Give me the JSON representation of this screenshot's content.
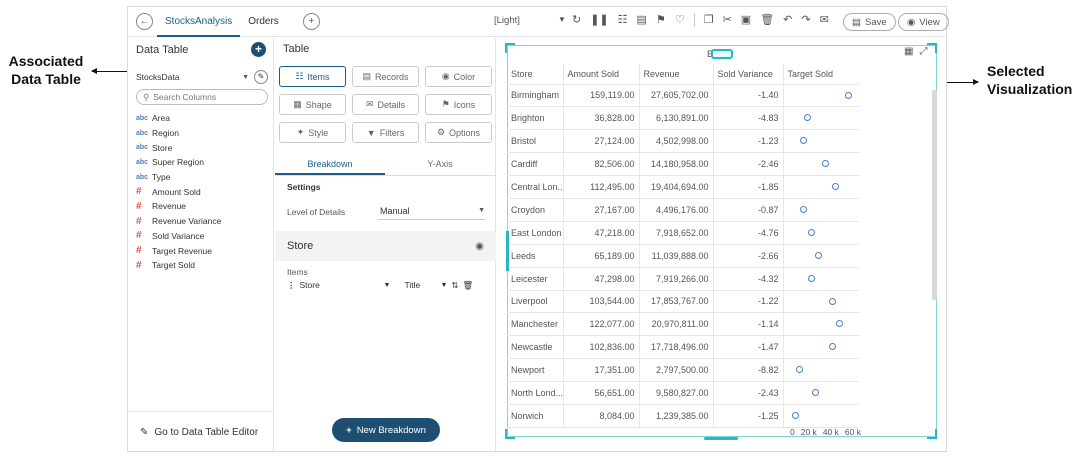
{
  "annotations": {
    "left_callout": [
      "Associated",
      "Data Table"
    ],
    "right_callout": [
      "Selected",
      "Visualization"
    ]
  },
  "topbar": {
    "tabs": [
      "StocksAnalysis",
      "Orders"
    ],
    "theme": "[Light]",
    "save_label": "Save",
    "view_label": "View"
  },
  "left_panel": {
    "title": "Data Table",
    "data_source": "StocksData",
    "search_placeholder": "Search Columns",
    "columns": [
      {
        "type": "abc",
        "name": "Area"
      },
      {
        "type": "abc",
        "name": "Region"
      },
      {
        "type": "abc",
        "name": "Store"
      },
      {
        "type": "abc",
        "name": "Super Region"
      },
      {
        "type": "abc",
        "name": "Type"
      },
      {
        "type": "#",
        "name": "Amount Sold"
      },
      {
        "type": "#",
        "name": "Revenue"
      },
      {
        "type": "#",
        "name": "Revenue Variance"
      },
      {
        "type": "#",
        "name": "Sold Variance"
      },
      {
        "type": "#",
        "name": "Target Revenue"
      },
      {
        "type": "#",
        "name": "Target Sold"
      }
    ],
    "goto_label": "Go to Data Table Editor"
  },
  "mid_panel": {
    "title": "Table",
    "buttons": [
      "Items",
      "Records",
      "Color",
      "Shape",
      "Details",
      "Icons",
      "Style",
      "Filters",
      "Options"
    ],
    "subtabs": [
      "Breakdown",
      "Y-Axis"
    ],
    "settings_label": "Settings",
    "level_of_details_label": "Level of Details",
    "level_of_details_value": "Manual",
    "breakdown_name": "Store",
    "items_label": "Items",
    "item_column": "Store",
    "item_format": "Title",
    "new_breakdown_label": "New Breakdown"
  },
  "viz": {
    "title": "Bullet",
    "headers": [
      "Store",
      "Amount Sold",
      "Revenue",
      "Sold Variance",
      "Target Sold"
    ],
    "rows": [
      {
        "store": "Birmingham",
        "amount": "159,119.00",
        "revenue": "27,605,702.00",
        "variance": "-1.40",
        "target": 0.72
      },
      {
        "store": "Brighton",
        "amount": "36,828.00",
        "revenue": "6,130,891.00",
        "variance": "-4.83",
        "target": 0.2
      },
      {
        "store": "Bristol",
        "amount": "27,124.00",
        "revenue": "4,502,998.00",
        "variance": "-1.23",
        "target": 0.15
      },
      {
        "store": "Cardiff",
        "amount": "82,506.00",
        "revenue": "14,180,958.00",
        "variance": "-2.46",
        "target": 0.43
      },
      {
        "store": "Central Lon...",
        "amount": "112,495.00",
        "revenue": "19,404,694.00",
        "variance": "-1.85",
        "target": 0.56
      },
      {
        "store": "Croydon",
        "amount": "27,167.00",
        "revenue": "4,496,176.00",
        "variance": "-0.87",
        "target": 0.15
      },
      {
        "store": "East London",
        "amount": "47,218.00",
        "revenue": "7,918,652.00",
        "variance": "-4.76",
        "target": 0.26
      },
      {
        "store": "Leeds",
        "amount": "65,189.00",
        "revenue": "11,039,888.00",
        "variance": "-2.66",
        "target": 0.34
      },
      {
        "store": "Leicester",
        "amount": "47,298.00",
        "revenue": "7,919,266.00",
        "variance": "-4.32",
        "target": 0.26
      },
      {
        "store": "Liverpool",
        "amount": "103,544.00",
        "revenue": "17,853,767.00",
        "variance": "-1.22",
        "target": 0.52
      },
      {
        "store": "Manchester",
        "amount": "122,077.00",
        "revenue": "20,970,811.00",
        "variance": "-1.14",
        "target": 0.61
      },
      {
        "store": "Newcastle",
        "amount": "102,836.00",
        "revenue": "17,718,496.00",
        "variance": "-1.47",
        "target": 0.52
      },
      {
        "store": "Newport",
        "amount": "17,351.00",
        "revenue": "2,797,500.00",
        "variance": "-8.82",
        "target": 0.1
      },
      {
        "store": "North Lond...",
        "amount": "56,651.00",
        "revenue": "9,580,827.00",
        "variance": "-2.43",
        "target": 0.3
      },
      {
        "store": "Norwich",
        "amount": "8,084.00",
        "revenue": "1,239,385.00",
        "variance": "-1.25",
        "target": 0.05
      }
    ],
    "axis_ticks": [
      "0",
      "20 k",
      "40 k",
      "60 k"
    ]
  }
}
